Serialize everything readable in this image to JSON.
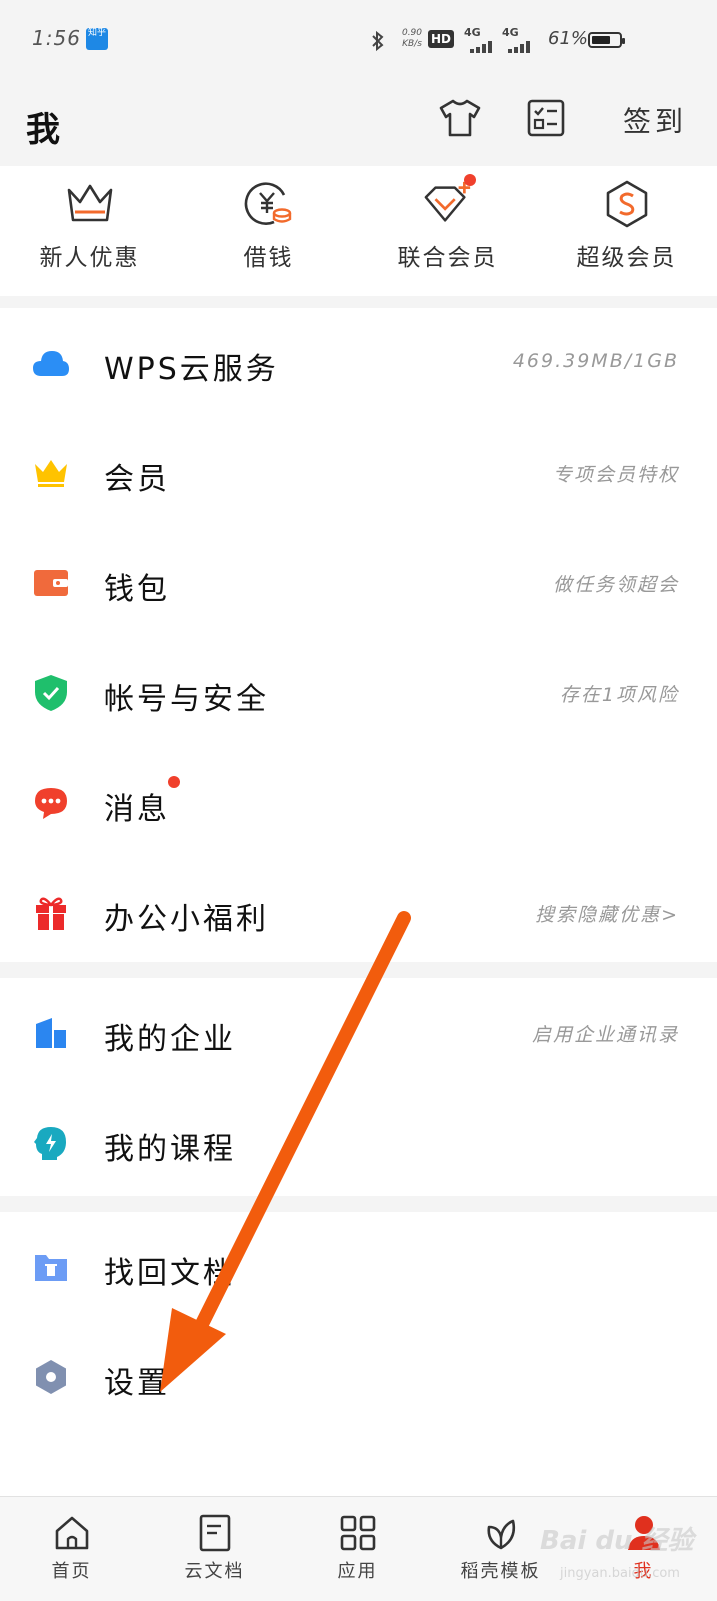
{
  "status_bar": {
    "time": "1:56",
    "app_icon_label": "知乎",
    "net_speed": "0.90 KB/s",
    "hd": "HD",
    "signal_1": "4G",
    "signal_2": "4G",
    "battery": "61%"
  },
  "header": {
    "title": "我",
    "checkin_label": "签到"
  },
  "vip_row": [
    {
      "label": "新人优惠",
      "icon": "crown-outline-icon"
    },
    {
      "label": "借钱",
      "icon": "yen-coin-icon"
    },
    {
      "label": "联合会员",
      "icon": "diamond-plus-icon"
    },
    {
      "label": "超级会员",
      "icon": "s-hexagon-icon"
    }
  ],
  "section1": [
    {
      "label": "WPS云服务",
      "desc": "469.39MB/1GB",
      "icon": "cloud-icon"
    },
    {
      "label": "会员",
      "desc": "专项会员特权",
      "icon": "crown-icon"
    },
    {
      "label": "钱包",
      "desc": "做任务领超会",
      "icon": "wallet-icon"
    },
    {
      "label": "帐号与安全",
      "desc": "存在1项风险",
      "icon": "shield-check-icon"
    },
    {
      "label": "消息",
      "desc": "",
      "icon": "message-icon"
    },
    {
      "label": "办公小福利",
      "desc": "搜索隐藏优惠>",
      "icon": "gift-icon"
    }
  ],
  "section2": [
    {
      "label": "我的企业",
      "desc": "启用企业通讯录",
      "icon": "enterprise-icon"
    },
    {
      "label": "我的课程",
      "desc": "",
      "icon": "course-icon"
    }
  ],
  "section3": [
    {
      "label": "找回文档",
      "desc": "",
      "icon": "recover-folder-icon"
    },
    {
      "label": "设置",
      "desc": "",
      "icon": "settings-icon"
    }
  ],
  "bottom_nav": [
    {
      "label": "首页",
      "icon": "home-icon"
    },
    {
      "label": "云文档",
      "icon": "document-icon"
    },
    {
      "label": "应用",
      "icon": "apps-icon"
    },
    {
      "label": "稻壳模板",
      "icon": "leaf-icon"
    },
    {
      "label": "我",
      "icon": "user-icon"
    }
  ],
  "watermark": {
    "text": "Bai du 经验",
    "sub": "jingyan.baidu.com"
  },
  "colors": {
    "accent_red": "#e0301e",
    "arrow_orange": "#f25c0d",
    "cloud_blue": "#2b8ef5",
    "crown_yellow": "#ffc300",
    "wallet_orange": "#f06a3c",
    "shield_green": "#1fbf6c",
    "message_red": "#f0402c",
    "gift_red": "#ec2a2a",
    "enterprise_blue": "#2b86f0",
    "course_teal": "#19a9c0",
    "folder_blue": "#6c9cf5",
    "settings_gray": "#8090b0"
  }
}
